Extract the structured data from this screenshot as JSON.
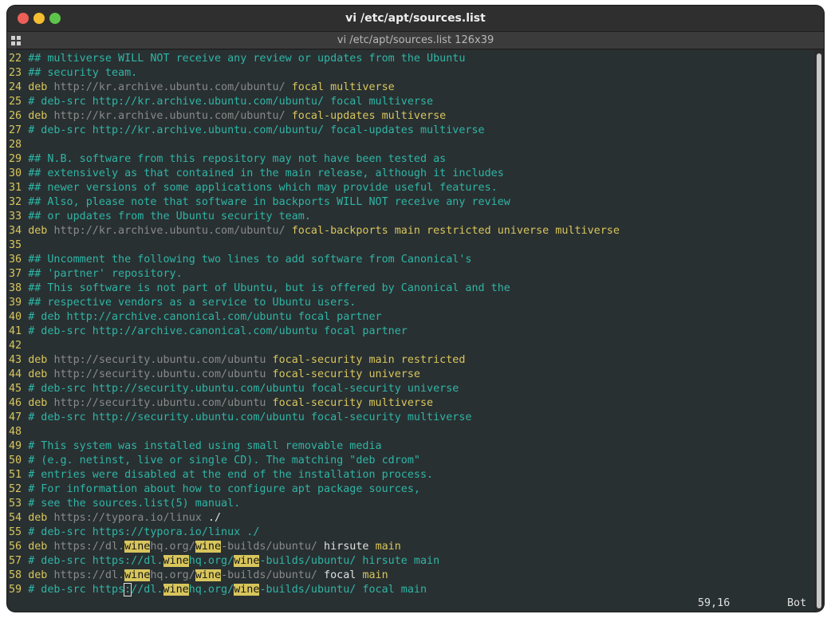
{
  "window": {
    "title": "vi /etc/apt/sources.list",
    "tab_title": "vi /etc/apt/sources.list 126x39"
  },
  "lines": [
    {
      "n": "22",
      "segs": [
        [
          "c",
          "## multiverse WILL NOT receive any review or updates from the Ubuntu"
        ]
      ]
    },
    {
      "n": "23",
      "segs": [
        [
          "c",
          "## security team."
        ]
      ]
    },
    {
      "n": "24",
      "segs": [
        [
          "k",
          "deb"
        ],
        [
          "p",
          " "
        ],
        [
          "u",
          "http://kr.archive.ubuntu.com/ubuntu/"
        ],
        [
          "p",
          " "
        ],
        [
          "v",
          "focal multiverse"
        ]
      ]
    },
    {
      "n": "25",
      "segs": [
        [
          "c",
          "# deb-src http://kr.archive.ubuntu.com/ubuntu/ focal multiverse"
        ]
      ]
    },
    {
      "n": "26",
      "segs": [
        [
          "k",
          "deb"
        ],
        [
          "p",
          " "
        ],
        [
          "u",
          "http://kr.archive.ubuntu.com/ubuntu/"
        ],
        [
          "p",
          " "
        ],
        [
          "v",
          "focal-updates multiverse"
        ]
      ]
    },
    {
      "n": "27",
      "segs": [
        [
          "c",
          "# deb-src http://kr.archive.ubuntu.com/ubuntu/ focal-updates multiverse"
        ]
      ]
    },
    {
      "n": "28",
      "segs": []
    },
    {
      "n": "29",
      "segs": [
        [
          "c",
          "## N.B. software from this repository may not have been tested as"
        ]
      ]
    },
    {
      "n": "30",
      "segs": [
        [
          "c",
          "## extensively as that contained in the main release, although it includes"
        ]
      ]
    },
    {
      "n": "31",
      "segs": [
        [
          "c",
          "## newer versions of some applications which may provide useful features."
        ]
      ]
    },
    {
      "n": "32",
      "segs": [
        [
          "c",
          "## Also, please note that software in backports WILL NOT receive any review"
        ]
      ]
    },
    {
      "n": "33",
      "segs": [
        [
          "c",
          "## or updates from the Ubuntu security team."
        ]
      ]
    },
    {
      "n": "34",
      "segs": [
        [
          "k",
          "deb"
        ],
        [
          "p",
          " "
        ],
        [
          "u",
          "http://kr.archive.ubuntu.com/ubuntu/"
        ],
        [
          "p",
          " "
        ],
        [
          "v",
          "focal-backports main restricted universe multiverse"
        ]
      ]
    },
    {
      "n": "35",
      "segs": []
    },
    {
      "n": "36",
      "segs": [
        [
          "c",
          "## Uncomment the following two lines to add software from Canonical's"
        ]
      ]
    },
    {
      "n": "37",
      "segs": [
        [
          "c",
          "## 'partner' repository."
        ]
      ]
    },
    {
      "n": "38",
      "segs": [
        [
          "c",
          "## This software is not part of Ubuntu, but is offered by Canonical and the"
        ]
      ]
    },
    {
      "n": "39",
      "segs": [
        [
          "c",
          "## respective vendors as a service to Ubuntu users."
        ]
      ]
    },
    {
      "n": "40",
      "segs": [
        [
          "c",
          "# deb http://archive.canonical.com/ubuntu focal partner"
        ]
      ]
    },
    {
      "n": "41",
      "segs": [
        [
          "c",
          "# deb-src http://archive.canonical.com/ubuntu focal partner"
        ]
      ]
    },
    {
      "n": "42",
      "segs": []
    },
    {
      "n": "43",
      "segs": [
        [
          "k",
          "deb"
        ],
        [
          "p",
          " "
        ],
        [
          "u",
          "http://security.ubuntu.com/ubuntu"
        ],
        [
          "p",
          " "
        ],
        [
          "v",
          "focal-security main restricted"
        ]
      ]
    },
    {
      "n": "44",
      "segs": [
        [
          "k",
          "deb"
        ],
        [
          "p",
          " "
        ],
        [
          "u",
          "http://security.ubuntu.com/ubuntu"
        ],
        [
          "p",
          " "
        ],
        [
          "v",
          "focal-security universe"
        ]
      ]
    },
    {
      "n": "45",
      "segs": [
        [
          "c",
          "# deb-src http://security.ubuntu.com/ubuntu focal-security universe"
        ]
      ]
    },
    {
      "n": "46",
      "segs": [
        [
          "k",
          "deb"
        ],
        [
          "p",
          " "
        ],
        [
          "u",
          "http://security.ubuntu.com/ubuntu"
        ],
        [
          "p",
          " "
        ],
        [
          "v",
          "focal-security multiverse"
        ]
      ]
    },
    {
      "n": "47",
      "segs": [
        [
          "c",
          "# deb-src http://security.ubuntu.com/ubuntu focal-security multiverse"
        ]
      ]
    },
    {
      "n": "48",
      "segs": []
    },
    {
      "n": "49",
      "segs": [
        [
          "c",
          "# This system was installed using small removable media"
        ]
      ]
    },
    {
      "n": "50",
      "segs": [
        [
          "c",
          "# (e.g. netinst, live or single CD). The matching \"deb cdrom\""
        ]
      ]
    },
    {
      "n": "51",
      "segs": [
        [
          "c",
          "# entries were disabled at the end of the installation process."
        ]
      ]
    },
    {
      "n": "52",
      "segs": [
        [
          "c",
          "# For information about how to configure apt package sources,"
        ]
      ]
    },
    {
      "n": "53",
      "segs": [
        [
          "c",
          "# see the sources.list(5) manual."
        ]
      ]
    },
    {
      "n": "54",
      "segs": [
        [
          "k",
          "deb"
        ],
        [
          "p",
          " "
        ],
        [
          "u",
          "https://typora.io/linux"
        ],
        [
          "p",
          " ./"
        ]
      ]
    },
    {
      "n": "55",
      "segs": [
        [
          "c",
          "# deb-src https://typora.io/linux ./"
        ]
      ]
    },
    {
      "n": "56",
      "segs": [
        [
          "k",
          "deb"
        ],
        [
          "p",
          " "
        ],
        [
          "u",
          "https://dl."
        ],
        [
          "h",
          "wine"
        ],
        [
          "u",
          "hq.org/"
        ],
        [
          "h",
          "wine"
        ],
        [
          "u",
          "-builds/ubuntu/"
        ],
        [
          "p",
          " hirsute "
        ],
        [
          "v",
          "main"
        ]
      ]
    },
    {
      "n": "57",
      "segs": [
        [
          "c",
          "# deb-src https://dl."
        ],
        [
          "h",
          "wine"
        ],
        [
          "c",
          "hq.org/"
        ],
        [
          "h",
          "wine"
        ],
        [
          "c",
          "-builds/ubuntu/ hirsute main"
        ]
      ]
    },
    {
      "n": "58",
      "segs": [
        [
          "k",
          "deb"
        ],
        [
          "p",
          " "
        ],
        [
          "u",
          "https://dl."
        ],
        [
          "h",
          "wine"
        ],
        [
          "u",
          "hq.org/"
        ],
        [
          "h",
          "wine"
        ],
        [
          "u",
          "-builds/ubuntu/"
        ],
        [
          "p",
          " focal "
        ],
        [
          "v",
          "main"
        ]
      ]
    },
    {
      "n": "59",
      "segs": [
        [
          "c",
          "# deb-src https"
        ],
        [
          "x",
          ":"
        ],
        [
          "c",
          "//dl."
        ],
        [
          "h",
          "wine"
        ],
        [
          "c",
          "hq.org/"
        ],
        [
          "h",
          "wine"
        ],
        [
          "c",
          "-builds/ubuntu/ focal main"
        ]
      ]
    }
  ],
  "status": {
    "position": "59,16",
    "scroll": "Bot"
  }
}
